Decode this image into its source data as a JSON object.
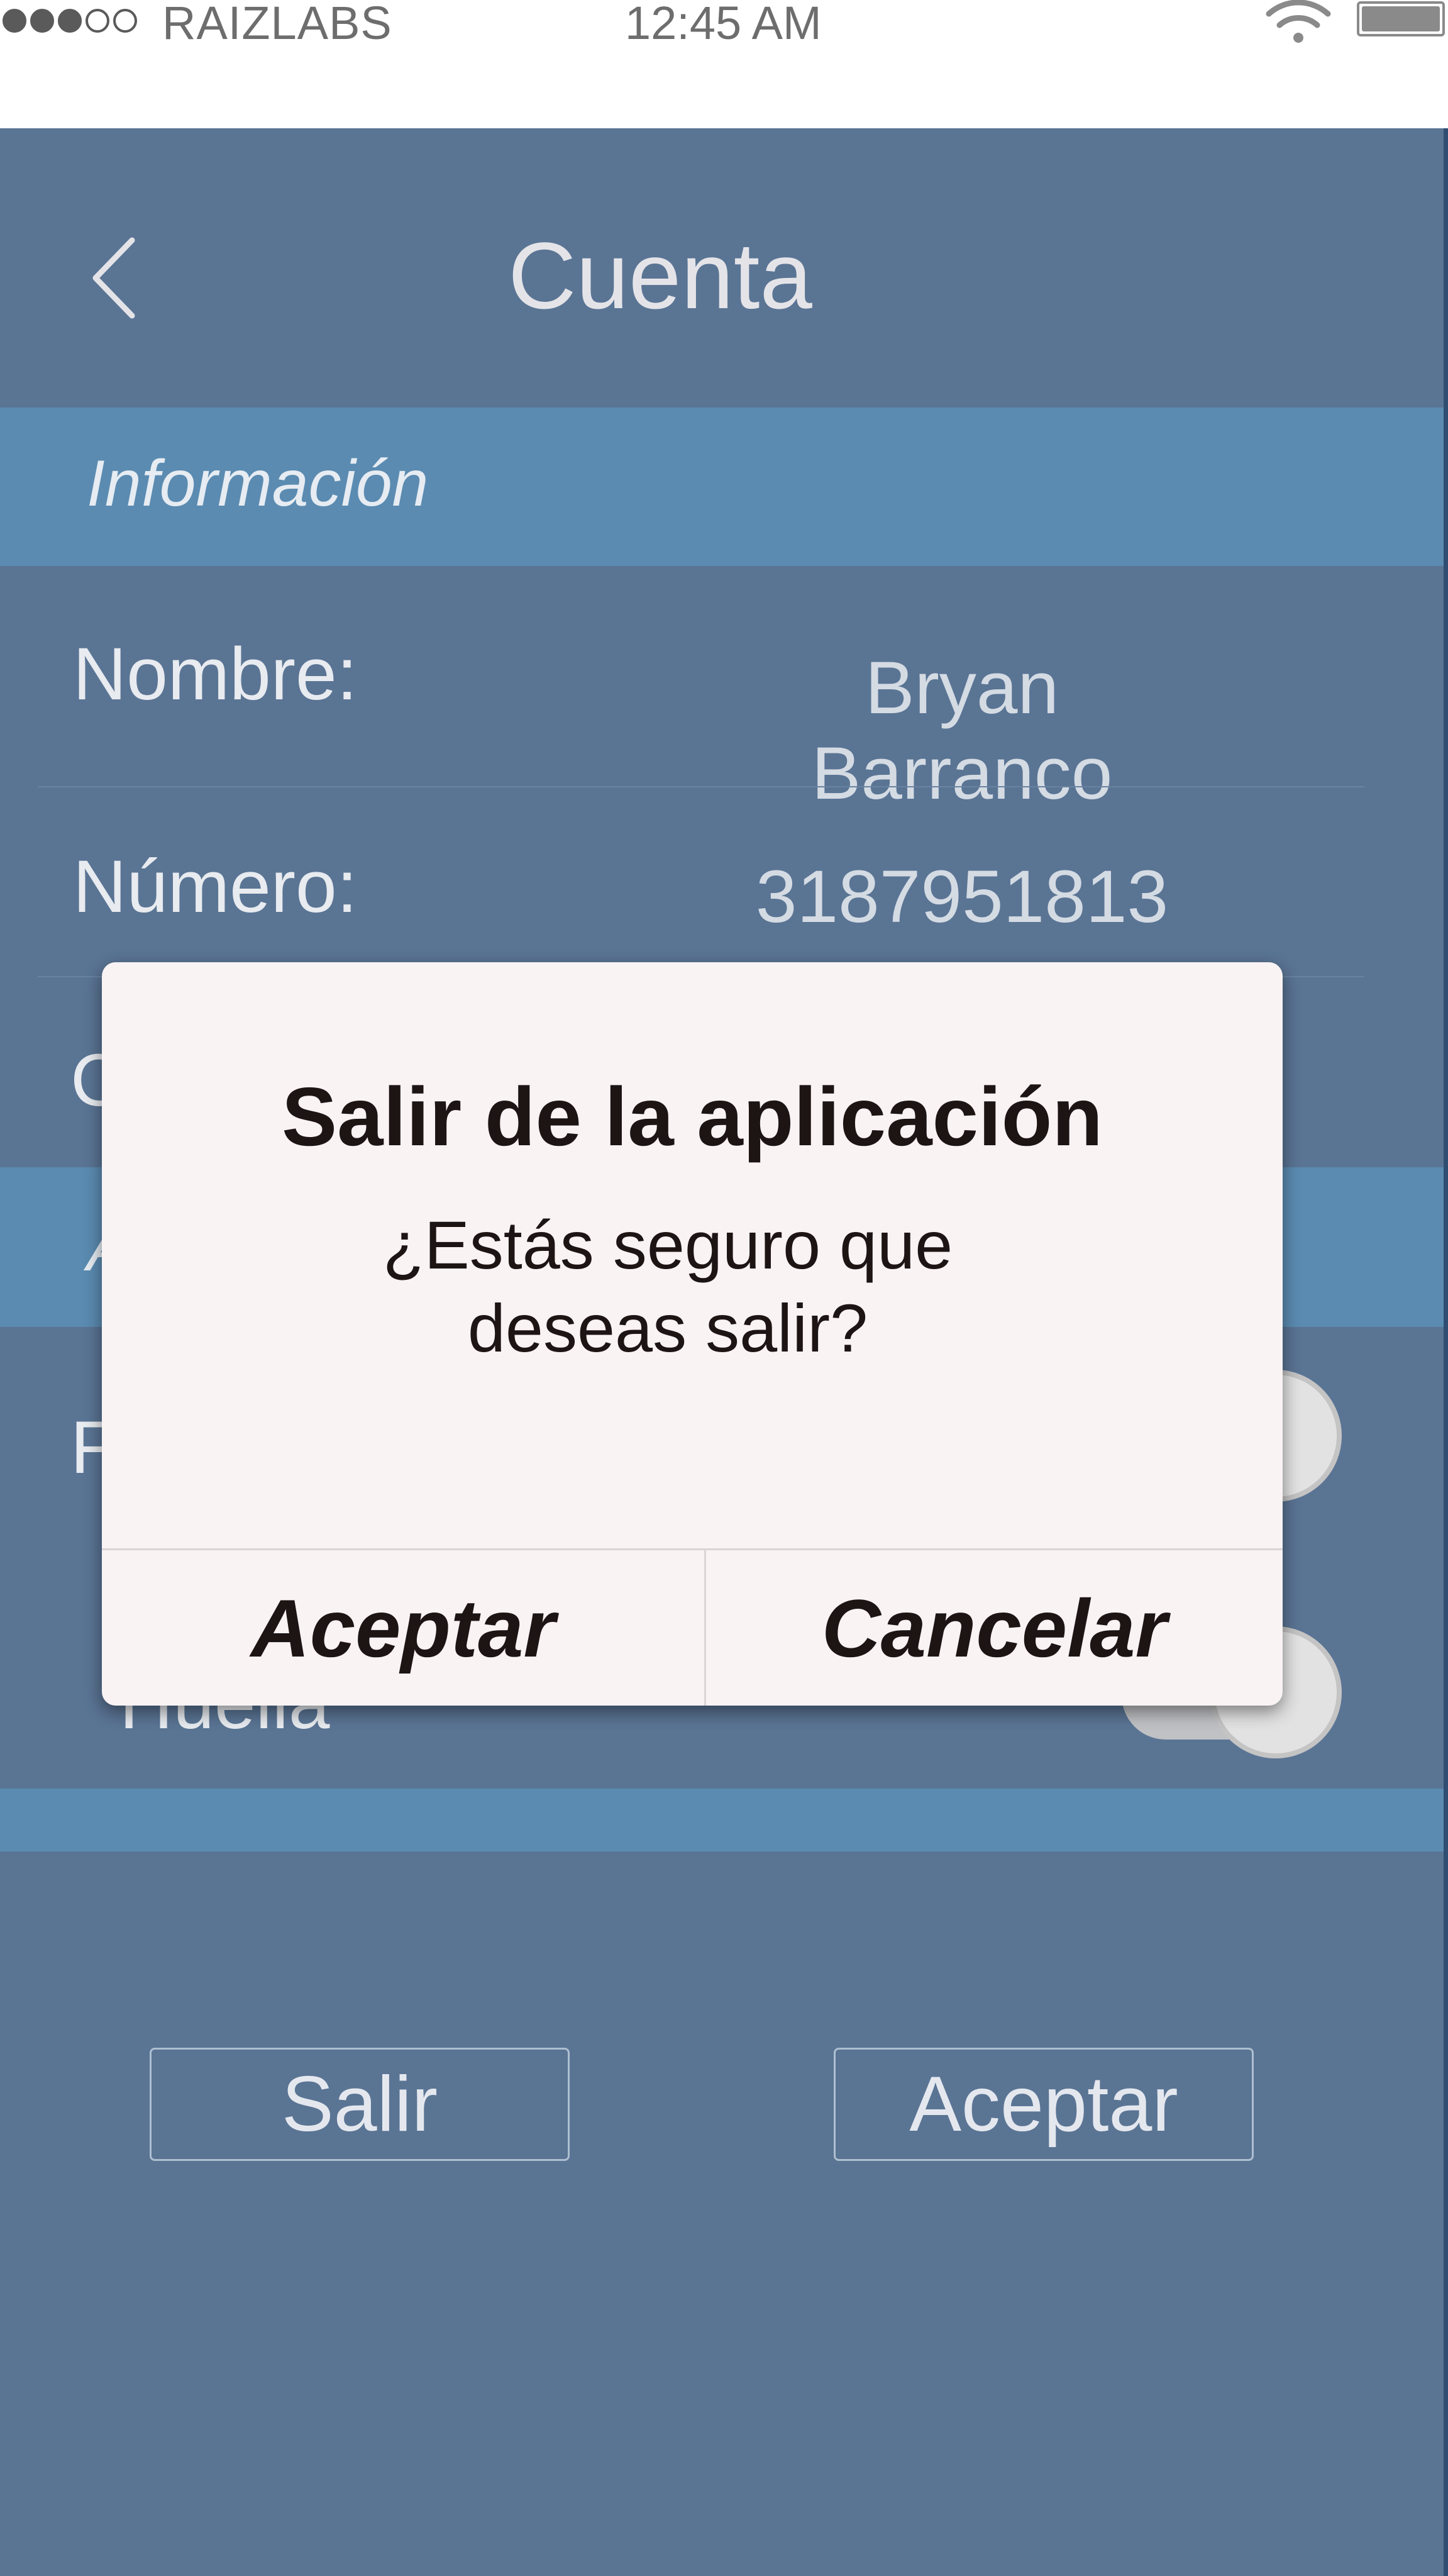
{
  "status_bar": {
    "carrier": "RAIZLABS",
    "time": "12:45 AM",
    "signal_dots_filled": 3,
    "signal_dots_total": 5,
    "icons": [
      "wifi-icon",
      "battery-icon"
    ]
  },
  "header": {
    "title": "Cuenta",
    "back_icon": "chevron-left-icon"
  },
  "info_section": {
    "label": "Información"
  },
  "fields": [
    {
      "label": "Nombre:",
      "value": "Bryan Barranco"
    },
    {
      "label": "Número:",
      "value": "3187951813"
    }
  ],
  "partial_texts": {
    "row3_initial": "C",
    "section2_initial": "A",
    "toggle1_label_initial": "F",
    "toggle2_label": "Huella"
  },
  "buttons": {
    "exit": "Salir",
    "accept": "Aceptar"
  },
  "dialog": {
    "title": "Salir de la aplicación",
    "message": "¿Estás seguro que deseas salir?",
    "confirm": "Aceptar",
    "cancel": "Cancelar"
  },
  "colors": {
    "screen_bg": "#5a7494",
    "section_bar": "#5b8bb1",
    "dialog_bg": "#f9f3f4",
    "dialog_text": "#1d1414"
  }
}
